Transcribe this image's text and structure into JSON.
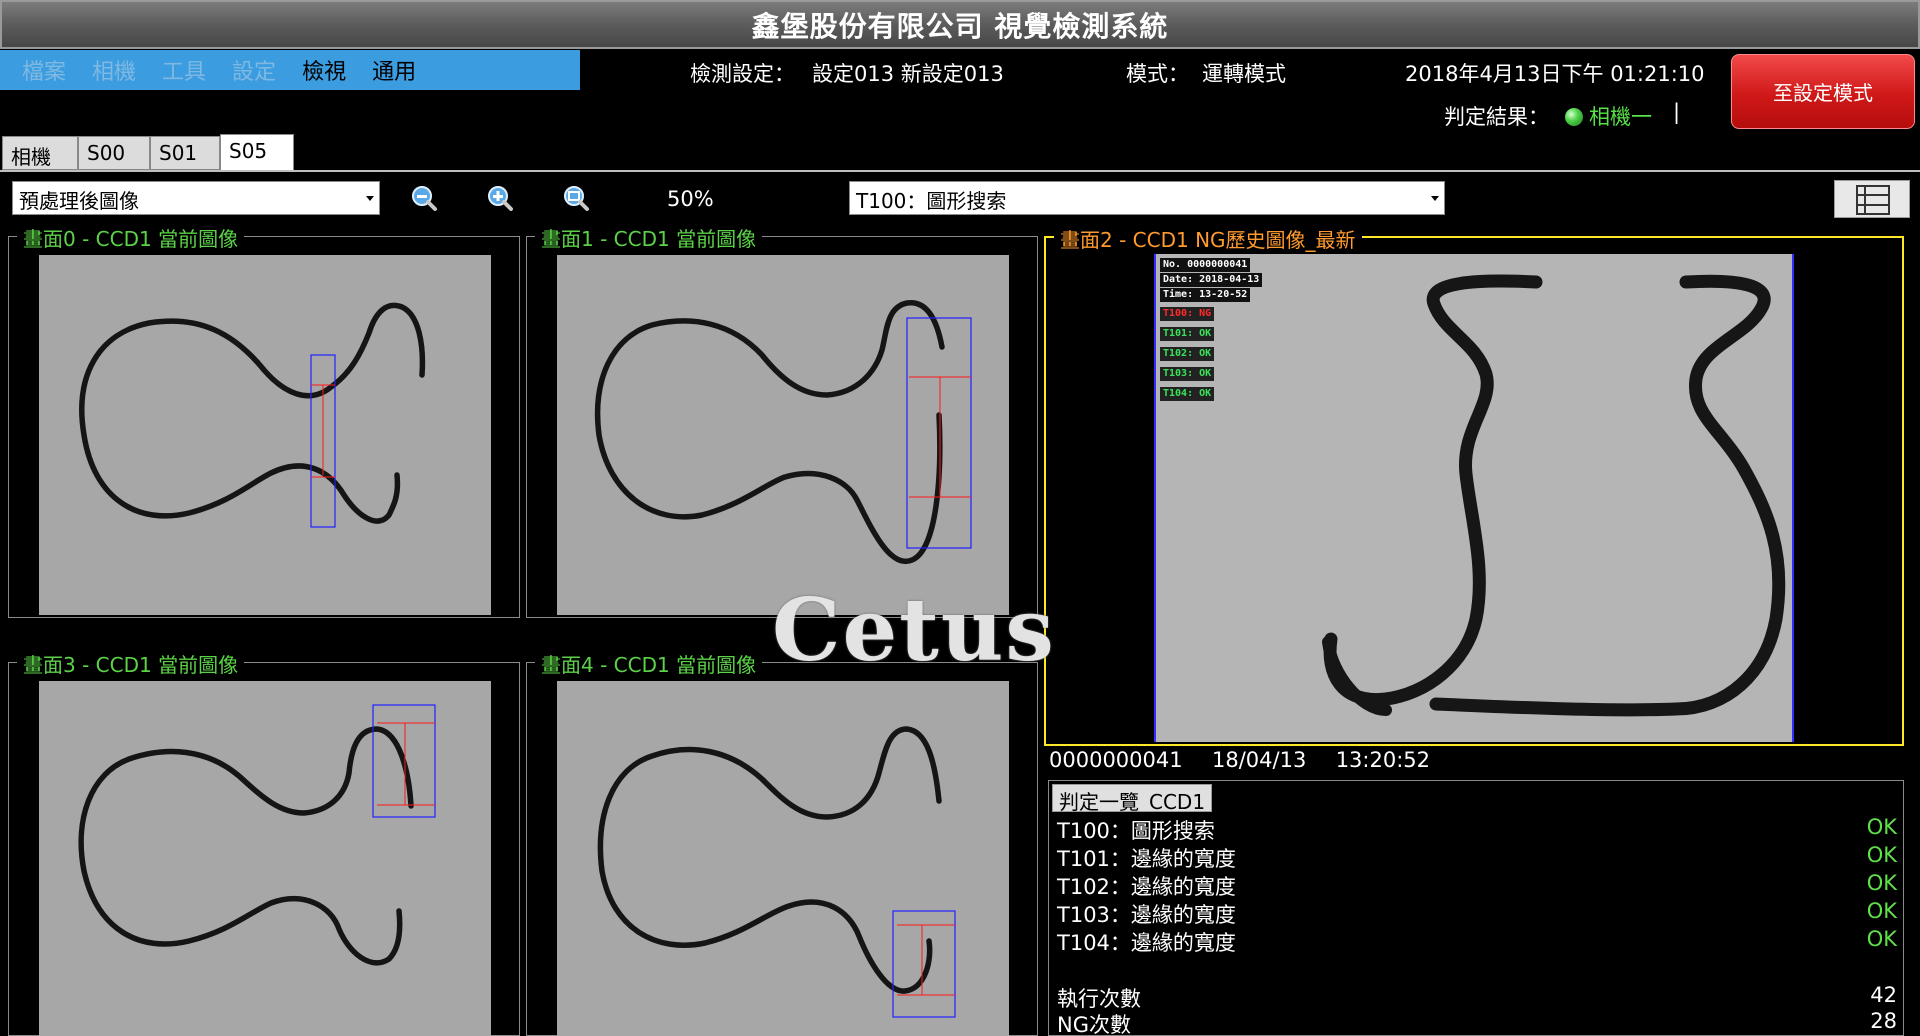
{
  "title": "鑫堡股份有限公司  視覺檢測系統",
  "menu": [
    "檔案",
    "相機",
    "工具",
    "設定",
    "檢視",
    "通用"
  ],
  "header": {
    "setting_label": "檢測設定：",
    "setting_value": "設定013  新設定013",
    "mode_label": "模式：",
    "mode_value": "運轉模式",
    "datetime": "2018年4月13日下午 01:21:10",
    "result_label": "判定結果：",
    "result_camera": "相機一",
    "result_sep": "|",
    "goto_button": "至設定模式"
  },
  "tabs": [
    "相機一",
    "S00",
    "S01",
    "S05"
  ],
  "toolbar": {
    "image_select": "預處理後圖像",
    "zoom_level": "50%",
    "tool_select": "T100：圖形搜索"
  },
  "panels": [
    {
      "title": "畫面0 - CCD1 當前圖像"
    },
    {
      "title": "畫面1 - CCD1 當前圖像"
    },
    {
      "title": "畫面2 - CCD1 NG歷史圖像_最新"
    },
    {
      "title": "畫面3 - CCD1 當前圖像"
    },
    {
      "title": "畫面4 - CCD1 當前圖像"
    }
  ],
  "ng_overlay": {
    "no": "No. 0000000041",
    "date": "Date: 2018-04-13",
    "time": "Time: 13-20-52",
    "results": [
      {
        "text": "T100: NG",
        "status": "ng"
      },
      {
        "text": "T101: OK",
        "status": "ok"
      },
      {
        "text": "T102: OK",
        "status": "ok"
      },
      {
        "text": "T103: OK",
        "status": "ok"
      },
      {
        "text": "T104: OK",
        "status": "ok"
      }
    ]
  },
  "meta": {
    "serial": "0000000041",
    "date": "18/04/13",
    "time": "13:20:52"
  },
  "results_list": {
    "header": "判定一覽_CCD1",
    "items": [
      {
        "tool": "T100：圖形搜索",
        "status": "OK"
      },
      {
        "tool": "T101：邊緣的寬度",
        "status": "OK"
      },
      {
        "tool": "T102：邊緣的寬度",
        "status": "OK"
      },
      {
        "tool": "T103：邊緣的寬度",
        "status": "OK"
      },
      {
        "tool": "T104：邊緣的寬度",
        "status": "OK"
      }
    ],
    "exec_label": "執行次數",
    "exec_count": "42",
    "ng_label": "NG次數",
    "ng_count": "28"
  },
  "watermark": "Cetus",
  "colors": {
    "menu_bg": "#3b9de0",
    "panel_title": "#5bd247",
    "ng_panel_title": "#ff9a2e",
    "highlight_border": "#ffe629",
    "ok": "#61e04b",
    "ng": "#ff2b2b"
  },
  "icons": [
    "zoom-out-icon",
    "zoom-in-icon",
    "zoom-fit-icon",
    "layout-grid-icon",
    "status-led-icon",
    "dropdown-arrow-icon"
  ]
}
